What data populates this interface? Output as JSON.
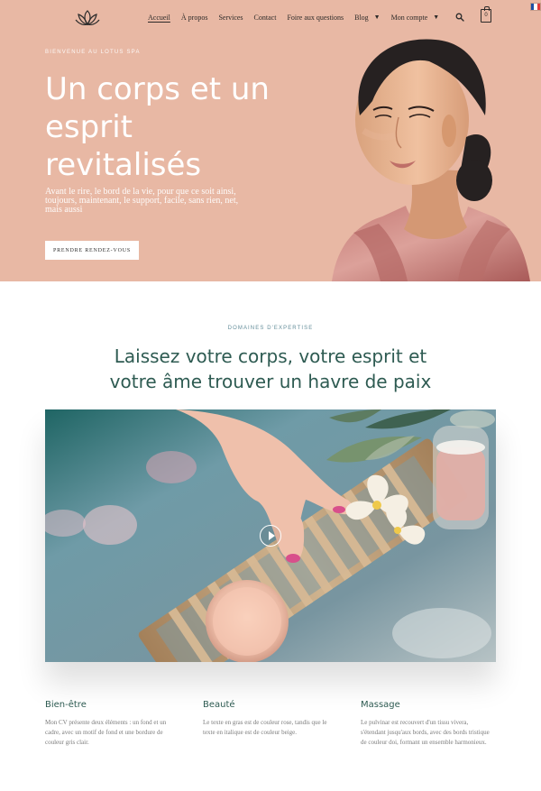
{
  "header": {
    "nav": [
      {
        "label": "Accueil"
      },
      {
        "label": "À propos"
      },
      {
        "label": "Services"
      },
      {
        "label": "Contact"
      },
      {
        "label": "Foire aux questions"
      },
      {
        "label": "Blog"
      },
      {
        "label": "Mon compte"
      }
    ],
    "cart_count": "0"
  },
  "hero": {
    "kicker": "BIENVENUE AU LOTUS SPA",
    "title": "Un corps et un esprit revitalisés",
    "text": "Avant le rire, le bord de la vie, pour que ce soit ainsi, toujours, maintenant, le support, facile, sans rien, net, mais aussi",
    "button_label": "PRENDRE RENDEZ-VOUS"
  },
  "section": {
    "kicker": "DOMAINES D'EXPERTISE",
    "title": "Laissez votre corps, votre esprit et votre âme trouver un havre de paix"
  },
  "features": [
    {
      "title": "Bien-être",
      "text": "Mon CV présente deux éléments : un fond et un cadre, avec un motif de fond et une bordure de couleur gris clair."
    },
    {
      "title": "Beauté",
      "text": "Le texte en gras est de couleur rose, tandis que le texte en italique est de couleur beige."
    },
    {
      "title": "Massage",
      "text": "Le pulvinar est recouvert d'un tissu vivera, s'étendant jusqu'aux bords, avec des bords tristique de couleur doi, formant un ensemble harmonieux."
    }
  ],
  "colors": {
    "hero_bg": "#e8b8a4",
    "accent": "#2e5b52",
    "kicker_blue": "#648e9a"
  }
}
